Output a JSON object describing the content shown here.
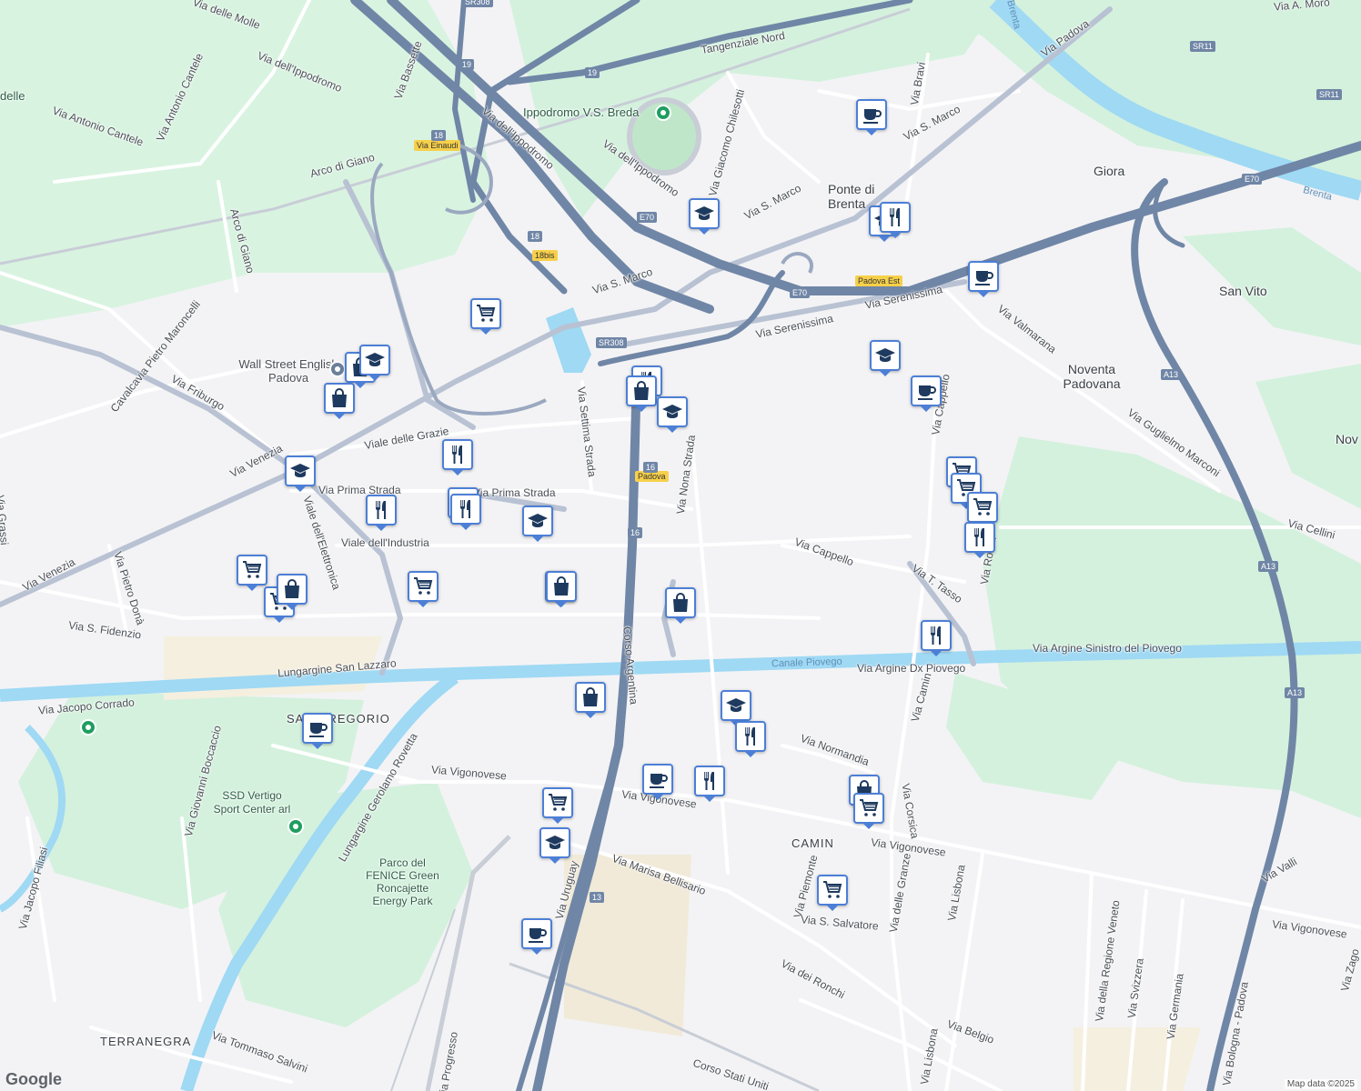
{
  "labels": {
    "street": [
      "Via delle Molle",
      "Via dell'Ippodromo",
      "Via Bassette",
      "Via Antonio Cantele",
      "Via Antonio Cantele",
      "Arco di Giano",
      "Arco di Giano",
      "Via dell'Ippodromo",
      "Via dell'Ippodromo",
      "Tangenziale Nord",
      "Via S. Marco",
      "Via S. Marco",
      "Via S. Marco",
      "Via Bravi",
      "Via Padova",
      "Via Giacomo Chilesotti",
      "Via Serenissima",
      "Via Serenissima",
      "Via Valmarana",
      "Cavalcavia Pietro Maroncelli",
      "Via Friburgo",
      "Viale delle Grazie",
      "Via Settima Strada",
      "Via Nona Strada",
      "Via Prima Strada",
      "Via Prima Strada",
      "Viale dell'Industria",
      "Viale dell'Elettronica",
      "Via Venezia",
      "Via Venezia",
      "Via Pietro Donà",
      "Via S. Fidenzio",
      "Via Cappello",
      "Via Cappello",
      "Via T. Tasso",
      "Via Guglielmo Marconi",
      "Via Cellini",
      "Via Argine Sinistro del Piovego",
      "Via Argine Dx Piovego",
      "Lungargine San Lazzaro",
      "Via Jacopo Corrado",
      "Corso Argentina",
      "Via Camin",
      "Via Normandia",
      "Via Vigonovese",
      "Via Vigonovese",
      "Via Vigonovese",
      "Via Vigonovese",
      "Via Giovanni Boccaccio",
      "Lungargine Gerolamo Rovetta",
      "Via Jacopo Filiasi",
      "Via Marisa Bellisario",
      "Via Piemonte",
      "Via S. Salvatore",
      "Via delle Granze",
      "Via Corsica",
      "Via Lisbona",
      "Via Lisbona",
      "Via dei Ronchi",
      "Via Belgio",
      "Via della Regione Veneto",
      "Via Svizzera",
      "Via Germania",
      "Via Valli",
      "Via Tommaso Salvini",
      "Corso Stati Uniti",
      "Via Progresso",
      "Via Zago",
      "Via A. Moro",
      "Via Einaudi",
      "Via Roma",
      "Via Bologna - Padova",
      "Padova Est",
      "Padova",
      "Via Uruguay",
      "Via Grassi"
    ],
    "areas": [
      "Giora",
      "Ponte di Brenta",
      "San Vito",
      "Noventa Padovana",
      "Nov",
      "SAN GREGORIO",
      "CAMIN",
      "TERRANEGRA"
    ],
    "pois": [
      "Ippodromo V.S. Breda",
      "Wall Street English Padova",
      "SSD Vertigo Sport Center arl",
      "Parco del FENICE Green Roncajette Energy Park",
      "delle"
    ],
    "water": [
      "Canale Piovego",
      "Brenta",
      "Brenta"
    ],
    "shields": [
      "SR308",
      "19",
      "19",
      "18",
      "18",
      "18bis",
      "E70",
      "E70",
      "E70",
      "SR308",
      "16",
      "16",
      "13",
      "A13",
      "A13",
      "A13",
      "SR11",
      "SR11"
    ]
  },
  "markers": [
    {
      "icon": "coffee-icon",
      "category": "cafe"
    },
    {
      "icon": "graduation-cap-icon",
      "category": "school"
    },
    {
      "icon": "graduation-cap-icon",
      "category": "school"
    },
    {
      "icon": "restaurant-icon",
      "category": "restaurant"
    },
    {
      "icon": "coffee-icon",
      "category": "cafe"
    },
    {
      "icon": "shopping-cart-icon",
      "category": "supermarket"
    },
    {
      "icon": "shopping-bag-icon",
      "category": "shop"
    },
    {
      "icon": "shopping-bag-icon",
      "category": "shop"
    },
    {
      "icon": "graduation-cap-icon",
      "category": "school"
    },
    {
      "icon": "restaurant-icon",
      "category": "restaurant"
    },
    {
      "icon": "shopping-bag-icon",
      "category": "shop"
    },
    {
      "icon": "graduation-cap-icon",
      "category": "school"
    },
    {
      "icon": "graduation-cap-icon",
      "category": "school"
    },
    {
      "icon": "restaurant-icon",
      "category": "restaurant"
    },
    {
      "icon": "restaurant-icon",
      "category": "restaurant"
    },
    {
      "icon": "restaurant-icon",
      "category": "restaurant"
    },
    {
      "icon": "restaurant-icon",
      "category": "restaurant"
    },
    {
      "icon": "graduation-cap-icon",
      "category": "school"
    },
    {
      "icon": "shopping-bag-icon",
      "category": "shop"
    },
    {
      "icon": "shopping-cart-icon",
      "category": "supermarket"
    },
    {
      "icon": "shopping-cart-icon",
      "category": "supermarket"
    },
    {
      "icon": "shopping-cart-icon",
      "category": "supermarket"
    },
    {
      "icon": "shopping-cart-icon",
      "category": "supermarket"
    },
    {
      "icon": "restaurant-icon",
      "category": "restaurant"
    },
    {
      "icon": "coffee-icon",
      "category": "cafe"
    },
    {
      "icon": "shopping-cart-icon",
      "category": "supermarket"
    },
    {
      "icon": "shopping-cart-icon",
      "category": "supermarket"
    },
    {
      "icon": "shopping-bag-icon",
      "category": "shop"
    },
    {
      "icon": "graduation-cap-icon",
      "category": "school"
    },
    {
      "icon": "shopping-bag-icon",
      "category": "shop"
    },
    {
      "icon": "shopping-bag-icon",
      "category": "shop"
    },
    {
      "icon": "restaurant-icon",
      "category": "restaurant"
    },
    {
      "icon": "shopping-bag-icon",
      "category": "shop"
    },
    {
      "icon": "coffee-icon",
      "category": "cafe"
    },
    {
      "icon": "graduation-cap-icon",
      "category": "school"
    },
    {
      "icon": "restaurant-icon",
      "category": "restaurant"
    },
    {
      "icon": "coffee-icon",
      "category": "cafe"
    },
    {
      "icon": "restaurant-icon",
      "category": "restaurant"
    },
    {
      "icon": "shopping-cart-icon",
      "category": "supermarket"
    },
    {
      "icon": "graduation-cap-icon",
      "category": "school"
    },
    {
      "icon": "shopping-cart-icon",
      "category": "supermarket"
    },
    {
      "icon": "shopping-bag-icon",
      "category": "shop"
    },
    {
      "icon": "shopping-cart-icon",
      "category": "supermarket"
    },
    {
      "icon": "coffee-icon",
      "category": "cafe"
    }
  ],
  "attribution": {
    "logo": "Google",
    "text": "Map data ©2025"
  },
  "colors": {
    "land": "#f3f3f5",
    "park": "#d4f1dd",
    "water": "#9fd9f4",
    "highway": "#7086a6",
    "road": "#ffffff",
    "marker_border": "#4c7fd6",
    "marker_icon": "#1e3a5f"
  }
}
